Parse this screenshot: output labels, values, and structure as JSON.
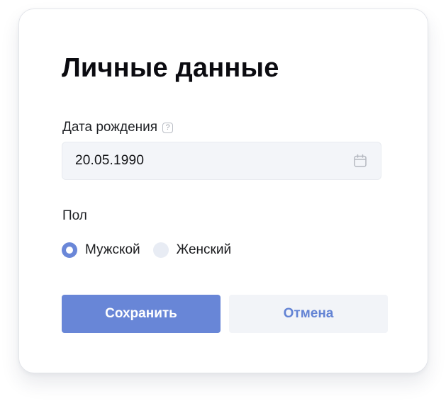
{
  "form": {
    "title": "Личные данные",
    "birth_date": {
      "label": "Дата рождения",
      "help_icon": "?",
      "value": "20.05.1990",
      "icon": "calendar-icon"
    },
    "gender": {
      "label": "Пол",
      "options": [
        {
          "label": "Мужской",
          "selected": true
        },
        {
          "label": "Женский",
          "selected": false
        }
      ]
    },
    "actions": {
      "save_label": "Сохранить",
      "cancel_label": "Отмена"
    }
  },
  "colors": {
    "accent": "#6886d7",
    "input_bg": "#f3f5f9",
    "secondary_bg": "#f2f4f8",
    "radio_unchecked": "#e8ecf4"
  }
}
